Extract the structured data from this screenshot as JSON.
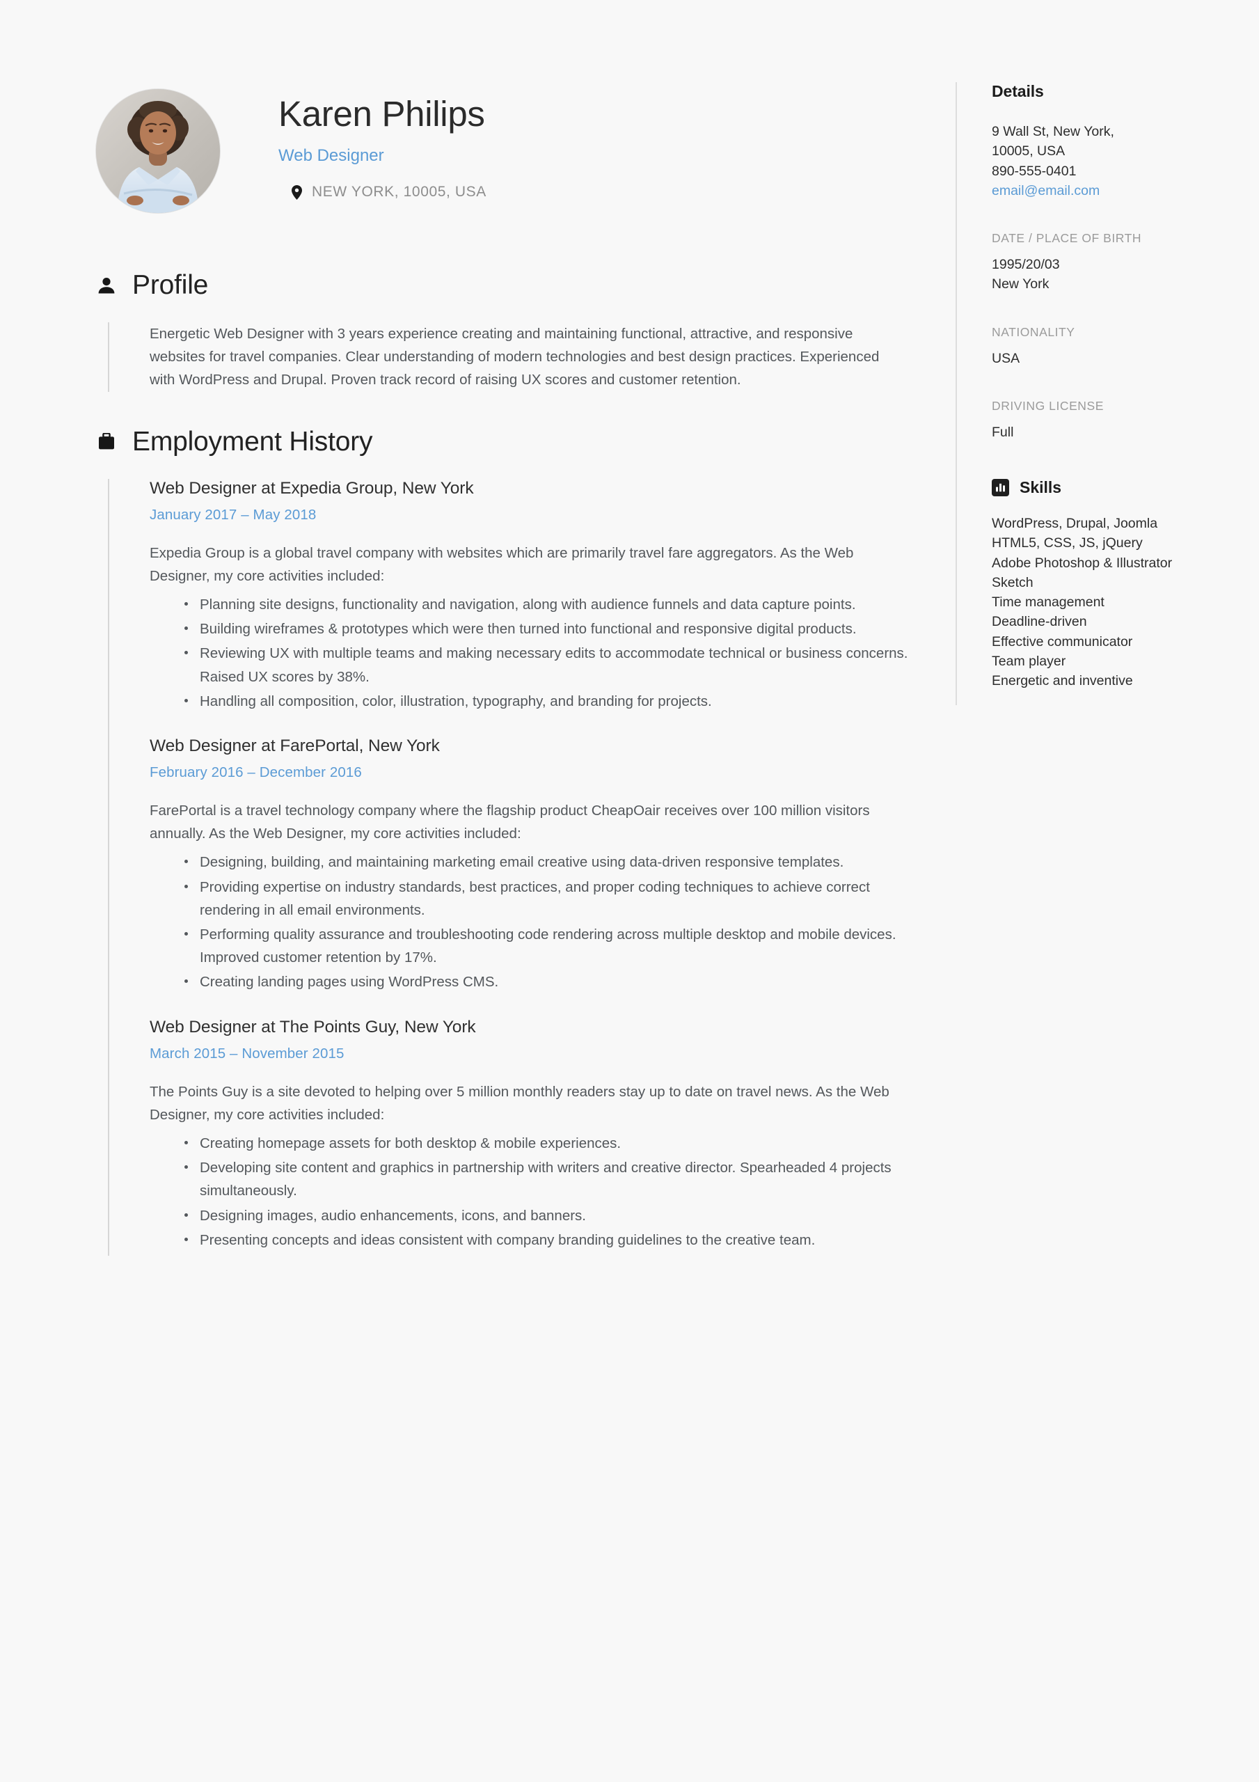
{
  "theme": {
    "accent": "#5b9bd5",
    "text": "#53575b",
    "heading": "#222222",
    "muted": "#9b9b9b",
    "background": "#f8f8f8",
    "rule": "#d6d6d6"
  },
  "header": {
    "name": "Karen Philips",
    "job_title": "Web Designer",
    "location": "NEW YORK, 10005, USA",
    "avatar_icon": "portrait-photo",
    "pin_icon": "location-pin-icon"
  },
  "profile": {
    "icon": "person-icon",
    "title": "Profile",
    "text": "Energetic Web Designer with 3 years experience creating and maintaining functional, attractive, and responsive websites for travel companies. Clear understanding of modern technologies and best design practices. Experienced with WordPress and Drupal. Proven track record of raising UX scores and customer retention."
  },
  "employment": {
    "icon": "briefcase-icon",
    "title": "Employment History",
    "jobs": [
      {
        "role": "Web Designer at Expedia Group, New York",
        "dates": "January 2017  –  May 2018",
        "description": "Expedia Group is a global travel company with websites which are primarily travel fare aggregators. As the Web Designer, my core activities included:",
        "bullets": [
          "Planning site designs, functionality and navigation, along with audience funnels and data capture points.",
          "Building wireframes & prototypes which were then turned into functional and responsive digital products.",
          "Reviewing UX with multiple teams and making necessary edits to accommodate technical or business concerns. Raised UX scores by 38%.",
          "Handling all composition, color, illustration, typography, and branding for projects."
        ]
      },
      {
        "role": "Web Designer at FarePortal, New York",
        "dates": "February 2016  –  December 2016",
        "description": "FarePortal is a travel technology company where the flagship product CheapOair receives over 100 million visitors annually. As the Web Designer, my core activities included:",
        "bullets": [
          "Designing, building, and maintaining marketing email creative using data-driven responsive templates.",
          "Providing expertise on industry standards, best practices, and proper coding techniques to achieve correct rendering in all email environments.",
          "Performing quality assurance and troubleshooting code rendering across multiple desktop and mobile devices. Improved customer retention by 17%.",
          "Creating landing pages using WordPress CMS."
        ]
      },
      {
        "role": "Web Designer at The Points Guy, New York",
        "dates": "March 2015  –  November 2015",
        "description": "The Points Guy is a site devoted to helping over 5 million monthly readers stay up to date on travel news. As the Web Designer, my core activities included:",
        "bullets": [
          "Creating homepage assets for both desktop & mobile experiences.",
          "Developing site content and graphics in partnership with writers and creative director. Spearheaded 4 projects simultaneously.",
          "Designing images, audio enhancements, icons, and banners.",
          "Presenting concepts and ideas consistent with company branding guidelines to the creative team."
        ]
      }
    ]
  },
  "sidebar": {
    "details_title": "Details",
    "address_line1": "9 Wall St, New York,",
    "address_line2": "10005, USA",
    "phone": "890-555-0401",
    "email": "email@email.com",
    "dob_label": "DATE / PLACE OF BIRTH",
    "dob_date": "1995/20/03",
    "dob_place": "New York",
    "nationality_label": "NATIONALITY",
    "nationality_value": "USA",
    "license_label": "DRIVING LICENSE",
    "license_value": "Full",
    "skills_icon": "bar-chart-icon",
    "skills_title": "Skills",
    "skills": [
      "WordPress, Drupal, Joomla",
      "HTML5, CSS, JS, jQuery",
      "Adobe Photoshop & Illustrator",
      "Sketch",
      "Time management",
      "Deadline-driven",
      "Effective communicator",
      "Team player",
      "Energetic and inventive"
    ]
  }
}
